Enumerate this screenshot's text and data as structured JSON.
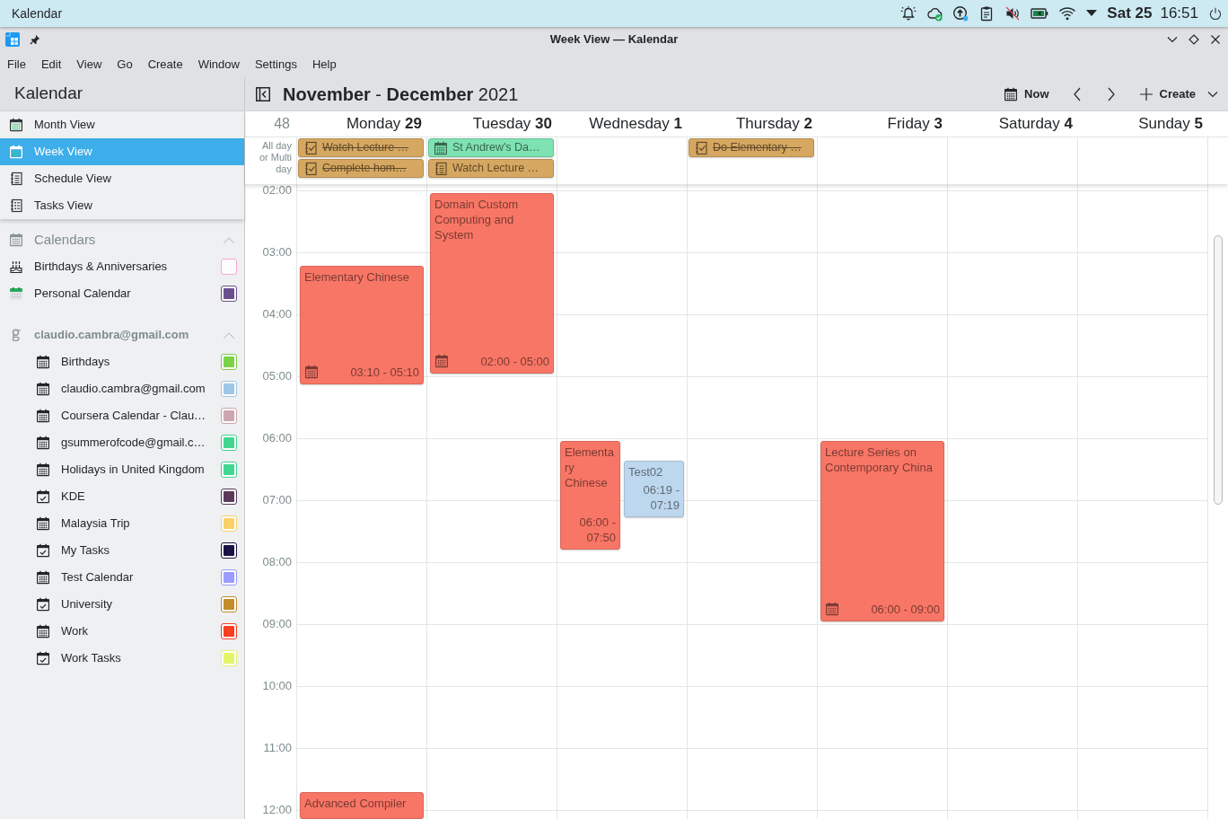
{
  "top_panel": {
    "app_name": "Kalendar",
    "date": "Sat 25",
    "time": "16:51"
  },
  "window": {
    "title": "Week View — Kalendar"
  },
  "menu_bar": [
    "File",
    "Edit",
    "View",
    "Go",
    "Create",
    "Window",
    "Settings",
    "Help"
  ],
  "sidebar": {
    "title": "Kalendar",
    "views": [
      {
        "label": "Month View",
        "kind": "month",
        "selected": false
      },
      {
        "label": "Week View",
        "kind": "week",
        "selected": true
      },
      {
        "label": "Schedule View",
        "kind": "schedule",
        "selected": false
      },
      {
        "label": "Tasks View",
        "kind": "tasks",
        "selected": false
      }
    ],
    "sources": [
      {
        "name": "Calendars",
        "kind": "local",
        "expanded": true,
        "calendars": [
          {
            "name": "Birthdays & Anniversaries",
            "kind": "birthdays",
            "color": "#f4a7d3",
            "checked": false
          },
          {
            "name": "Personal Calendar",
            "kind": "personal",
            "color": "#6b4f8f",
            "checked": true
          }
        ]
      },
      {
        "name": "claudio.cambra@gmail.com",
        "kind": "google",
        "expanded": true,
        "calendars": [
          {
            "name": "Birthdays",
            "kind": "events",
            "color": "#7bd148",
            "checked": true
          },
          {
            "name": "claudio.cambra@gmail.com",
            "kind": "events",
            "color": "#9fc6e7",
            "checked": true
          },
          {
            "name": "Coursera Calendar - Clau…",
            "kind": "events",
            "color": "#cca6ac",
            "checked": true
          },
          {
            "name": "gsummerofcode@gmail.c…",
            "kind": "events",
            "color": "#42d692",
            "checked": true
          },
          {
            "name": "Holidays in United Kingdom",
            "kind": "events",
            "color": "#42d692",
            "checked": true
          },
          {
            "name": "KDE",
            "kind": "tasks",
            "color": "#5a3b5c",
            "checked": true
          },
          {
            "name": "Malaysia Trip",
            "kind": "events",
            "color": "#fad165",
            "checked": true
          },
          {
            "name": "My Tasks",
            "kind": "tasks",
            "color": "#1a1446",
            "checked": true
          },
          {
            "name": "Test Calendar",
            "kind": "events",
            "color": "#9a9cff",
            "checked": true
          },
          {
            "name": "University",
            "kind": "tasks",
            "color": "#c28c2c",
            "checked": true
          },
          {
            "name": "Work",
            "kind": "events",
            "color": "#fa3e23",
            "checked": true
          },
          {
            "name": "Work Tasks",
            "kind": "tasks",
            "color": "#e4f46a",
            "checked": true
          }
        ]
      }
    ]
  },
  "toolbar": {
    "title": "**November** - **December** 2021",
    "buttons": [
      {
        "kind": "today",
        "label": "Now"
      },
      {
        "kind": "previous"
      },
      {
        "kind": "next"
      },
      {
        "kind": "create",
        "label": "Create"
      }
    ]
  },
  "week": {
    "week_number": "48",
    "all_day_label": "All day or Multi day",
    "hours": [
      "02:00",
      "03:00",
      "04:00",
      "05:00",
      "06:00",
      "07:00",
      "08:00",
      "09:00",
      "10:00",
      "11:00",
      "12:00"
    ],
    "days": [
      {
        "label": "Monday **29**",
        "all_day": [
          {
            "title": "Watch Lecture …",
            "kind": "task",
            "completed": true,
            "color": "#d6a760"
          },
          {
            "title": "Complete hom…",
            "kind": "task",
            "completed": true,
            "color": "#d6a760"
          }
        ],
        "events": [
          {
            "title": "Elementary Chinese",
            "time": "03:10 - 05:10",
            "color": "#f87666"
          },
          {
            "title": "Advanced Compiler",
            "color": "#f87666"
          }
        ]
      },
      {
        "label": "Tuesday **30**",
        "all_day": [
          {
            "title": "St Andrew's Da…",
            "kind": "event",
            "completed": false,
            "color": "#7ee2b2"
          },
          {
            "title": "Watch Lecture …",
            "kind": "journal",
            "completed": false,
            "color": "#d6a760"
          }
        ],
        "events": [
          {
            "title": "Domain Custom Computing and System",
            "time": "02:00 - 05:00",
            "color": "#f87666"
          }
        ]
      },
      {
        "label": "Wednesday **1**",
        "events": [
          {
            "title": "Elementary Chinese",
            "time": "06:00 - 07:50",
            "color": "#f87666"
          },
          {
            "title": "Test02",
            "time": "06:19 - 07:19",
            "color": "#bdd7ee"
          }
        ]
      },
      {
        "label": "Thursday **2**",
        "all_day": [
          {
            "title": "Do Elementary …",
            "kind": "task",
            "completed": true,
            "color": "#d6a760"
          }
        ]
      },
      {
        "label": "Friday **3**",
        "events": [
          {
            "title": "Lecture Series on Contemporary China",
            "time": "06:00 - 09:00",
            "color": "#f87666"
          }
        ]
      },
      {
        "label": "Saturday **4**"
      },
      {
        "label": "Sunday **5**"
      }
    ]
  }
}
